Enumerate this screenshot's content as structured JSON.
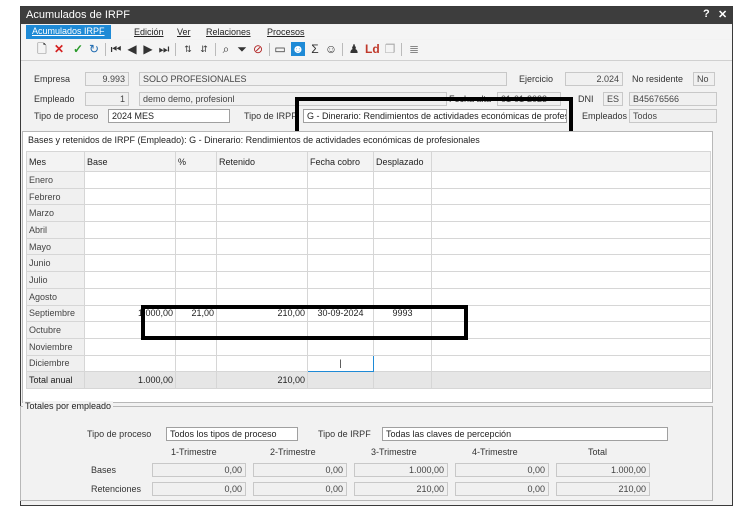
{
  "window": {
    "title": "Acumulados de IRPF",
    "help": "?",
    "close": "✕"
  },
  "menu": [
    "Acumulados IRPF",
    "Edición",
    "Ver",
    "Relaciones",
    "Procesos"
  ],
  "header": {
    "empresa_label": "Empresa",
    "empresa_code": "9.993",
    "empresa_name": "SOLO PROFESIONALES",
    "ejercicio_label": "Ejercicio",
    "ejercicio_value": "2.024",
    "no_residente_label": "No residente",
    "no_residente_value": "No",
    "empleado_label": "Empleado",
    "empleado_code": "1",
    "empleado_name": "demo demo, profesionl",
    "fecha_alta_label": "Fecha alta",
    "fecha_alta_value": "01-01-2023",
    "dni_label": "DNI",
    "dni_type": "ES",
    "dni_value": "B45676566",
    "tipo_proceso_label": "Tipo de proceso",
    "tipo_proceso_value": "2024 MES",
    "tipo_irpf_label": "Tipo de IRPF",
    "tipo_irpf_value": "G - Dinerario: Rendimientos de actividades económicas de profesionales",
    "empleados_label": "Empleados",
    "empleados_value": "Todos"
  },
  "grid": {
    "title": "Bases y retenidos de IRPF (Empleado): G - Dinerario: Rendimientos de actividades económicas de profesionales",
    "columns": [
      "Mes",
      "Base",
      "%",
      "Retenido",
      "Fecha cobro",
      "Desplazado"
    ],
    "rows": [
      [
        "Enero",
        "",
        "",
        "",
        "",
        ""
      ],
      [
        "Febrero",
        "",
        "",
        "",
        "",
        ""
      ],
      [
        "Marzo",
        "",
        "",
        "",
        "",
        ""
      ],
      [
        "Abril",
        "",
        "",
        "",
        "",
        ""
      ],
      [
        "Mayo",
        "",
        "",
        "",
        "",
        ""
      ],
      [
        "Junio",
        "",
        "",
        "",
        "",
        ""
      ],
      [
        "Julio",
        "",
        "",
        "",
        "",
        ""
      ],
      [
        "Agosto",
        "",
        "",
        "",
        "",
        ""
      ],
      [
        "Septiembre",
        "1.000,00",
        "21,00",
        "210,00",
        "30-09-2024",
        "9993"
      ],
      [
        "Octubre",
        "",
        "",
        "",
        "",
        ""
      ],
      [
        "Noviembre",
        "",
        "",
        "",
        "",
        ""
      ],
      [
        "Diciembre",
        "",
        "",
        "",
        "|",
        ""
      ]
    ],
    "total": [
      "Total anual",
      "1.000,00",
      "",
      "210,00",
      "",
      ""
    ]
  },
  "totales": {
    "legend": "Totales por empleado",
    "tipo_proceso_label": "Tipo de proceso",
    "tipo_proceso_value": "Todos los tipos de proceso",
    "tipo_irpf_label": "Tipo de IRPF",
    "tipo_irpf_value": "Todas las claves de percepción",
    "trimestres": [
      "1-Trimestre",
      "2-Trimestre",
      "3-Trimestre",
      "4-Trimestre",
      "Total"
    ],
    "bases_label": "Bases",
    "bases": [
      "0,00",
      "0,00",
      "1.000,00",
      "0,00",
      "1.000,00"
    ],
    "retenciones_label": "Retenciones",
    "retenciones": [
      "0,00",
      "0,00",
      "210,00",
      "0,00",
      "210,00"
    ]
  }
}
